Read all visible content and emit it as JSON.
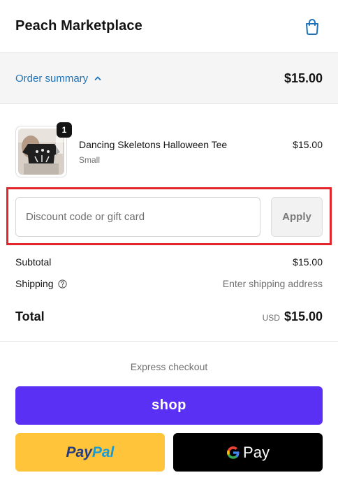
{
  "header": {
    "store_name": "Peach Marketplace",
    "cart_icon": "shopping-bag-icon"
  },
  "summary_bar": {
    "toggle_label": "Order summary",
    "toggle_icon": "chevron-up-icon",
    "total": "$15.00"
  },
  "product": {
    "title": "Dancing Skeletons Halloween Tee",
    "variant": "Small",
    "price": "$15.00",
    "quantity": "1"
  },
  "discount": {
    "placeholder": "Discount code or gift card",
    "value": "",
    "apply_label": "Apply"
  },
  "totals": {
    "subtotal_label": "Subtotal",
    "subtotal_value": "$15.00",
    "shipping_label": "Shipping",
    "shipping_value": "Enter shipping address",
    "total_label": "Total",
    "currency": "USD",
    "total_value": "$15.00"
  },
  "express": {
    "label": "Express checkout",
    "shop_label": "shop",
    "paypal_part1": "Pay",
    "paypal_part2": "Pal",
    "gpay_label": "Pay"
  },
  "colors": {
    "accent_link": "#1f72b8",
    "shop_pay": "#5a31f4",
    "paypal_yellow": "#ffc439",
    "highlight_red": "#e3262b"
  }
}
